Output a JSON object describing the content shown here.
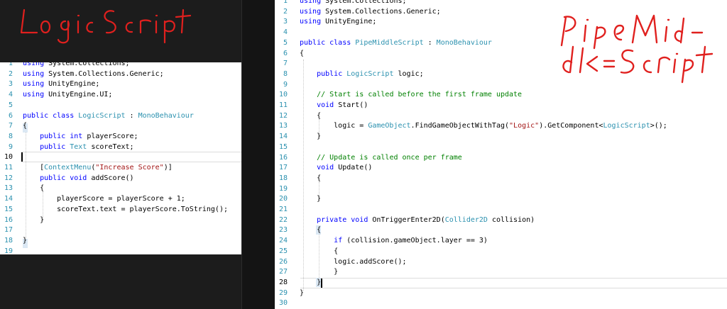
{
  "annotations": {
    "left_title": "LogicScript",
    "right_title": "PipeMiddleScript"
  },
  "left_editor": {
    "lines": [
      {
        "n": "1",
        "t": [
          [
            "k",
            "using"
          ],
          [
            "n",
            " System.Collections;"
          ]
        ]
      },
      {
        "n": "2",
        "t": [
          [
            "k",
            "using"
          ],
          [
            "n",
            " System.Collections.Generic;"
          ]
        ]
      },
      {
        "n": "3",
        "t": [
          [
            "k",
            "using"
          ],
          [
            "n",
            " UnityEngine;"
          ]
        ]
      },
      {
        "n": "4",
        "t": [
          [
            "k",
            "using"
          ],
          [
            "n",
            " UnityEngine.UI;"
          ]
        ]
      },
      {
        "n": "5",
        "t": []
      },
      {
        "n": "6",
        "t": [
          [
            "k",
            "public class"
          ],
          [
            "n",
            " "
          ],
          [
            "t",
            "LogicScript"
          ],
          [
            "n",
            " : "
          ],
          [
            "t",
            "MonoBehaviour"
          ]
        ]
      },
      {
        "n": "7",
        "t": [
          [
            "n",
            "{"
          ]
        ]
      },
      {
        "n": "8",
        "t": [
          [
            "n",
            "    "
          ],
          [
            "k",
            "public int"
          ],
          [
            "n",
            " playerScore;"
          ]
        ]
      },
      {
        "n": "9",
        "t": [
          [
            "n",
            "    "
          ],
          [
            "k",
            "public"
          ],
          [
            "n",
            " "
          ],
          [
            "t",
            "Text"
          ],
          [
            "n",
            " scoreText;"
          ]
        ]
      },
      {
        "n": "10",
        "t": []
      },
      {
        "n": "11",
        "t": [
          [
            "n",
            "    ["
          ],
          [
            "a",
            "ContextMenu"
          ],
          [
            "n",
            "("
          ],
          [
            "s",
            "\"Increase Score\""
          ],
          [
            "n",
            ")]"
          ]
        ]
      },
      {
        "n": "12",
        "t": [
          [
            "n",
            "    "
          ],
          [
            "k",
            "public void"
          ],
          [
            "n",
            " addScore()"
          ]
        ]
      },
      {
        "n": "13",
        "t": [
          [
            "n",
            "    {"
          ]
        ]
      },
      {
        "n": "14",
        "t": [
          [
            "n",
            "        playerScore = playerScore + 1;"
          ]
        ]
      },
      {
        "n": "15",
        "t": [
          [
            "n",
            "        scoreText.text = playerScore.ToString();"
          ]
        ]
      },
      {
        "n": "16",
        "t": [
          [
            "n",
            "    }"
          ]
        ]
      },
      {
        "n": "17",
        "t": []
      },
      {
        "n": "18",
        "t": [
          [
            "n",
            "}"
          ]
        ]
      },
      {
        "n": "19",
        "t": []
      }
    ]
  },
  "right_editor": {
    "lines": [
      {
        "n": "1",
        "t": [
          [
            "k",
            "using"
          ],
          [
            "n",
            " System.Collections;"
          ]
        ]
      },
      {
        "n": "2",
        "t": [
          [
            "k",
            "using"
          ],
          [
            "n",
            " System.Collections.Generic;"
          ]
        ]
      },
      {
        "n": "3",
        "t": [
          [
            "k",
            "using"
          ],
          [
            "n",
            " UnityEngine;"
          ]
        ]
      },
      {
        "n": "4",
        "t": []
      },
      {
        "n": "5",
        "t": [
          [
            "k",
            "public class"
          ],
          [
            "n",
            " "
          ],
          [
            "t",
            "PipeMiddleScript"
          ],
          [
            "n",
            " : "
          ],
          [
            "t",
            "MonoBehaviour"
          ]
        ]
      },
      {
        "n": "6",
        "t": [
          [
            "n",
            "{"
          ]
        ]
      },
      {
        "n": "7",
        "t": []
      },
      {
        "n": "8",
        "t": [
          [
            "n",
            "    "
          ],
          [
            "k",
            "public"
          ],
          [
            "n",
            " "
          ],
          [
            "t",
            "LogicScript"
          ],
          [
            "n",
            " logic;"
          ]
        ]
      },
      {
        "n": "9",
        "t": []
      },
      {
        "n": "10",
        "t": [
          [
            "n",
            "    "
          ],
          [
            "c",
            "// Start is called before the first frame update"
          ]
        ]
      },
      {
        "n": "11",
        "t": [
          [
            "n",
            "    "
          ],
          [
            "k",
            "void"
          ],
          [
            "n",
            " Start()"
          ]
        ]
      },
      {
        "n": "12",
        "t": [
          [
            "n",
            "    {"
          ]
        ]
      },
      {
        "n": "13",
        "t": [
          [
            "n",
            "        logic = "
          ],
          [
            "t",
            "GameObject"
          ],
          [
            "n",
            ".FindGameObjectWithTag("
          ],
          [
            "s",
            "\"Logic\""
          ],
          [
            "n",
            ").GetComponent<"
          ],
          [
            "t",
            "LogicScript"
          ],
          [
            "n",
            ">();"
          ]
        ]
      },
      {
        "n": "14",
        "t": [
          [
            "n",
            "    }"
          ]
        ]
      },
      {
        "n": "15",
        "t": []
      },
      {
        "n": "16",
        "t": [
          [
            "n",
            "    "
          ],
          [
            "c",
            "// Update is called once per frame"
          ]
        ]
      },
      {
        "n": "17",
        "t": [
          [
            "n",
            "    "
          ],
          [
            "k",
            "void"
          ],
          [
            "n",
            " Update()"
          ]
        ]
      },
      {
        "n": "18",
        "t": [
          [
            "n",
            "    {"
          ]
        ]
      },
      {
        "n": "19",
        "t": []
      },
      {
        "n": "20",
        "t": [
          [
            "n",
            "    }"
          ]
        ]
      },
      {
        "n": "21",
        "t": []
      },
      {
        "n": "22",
        "t": [
          [
            "n",
            "    "
          ],
          [
            "k",
            "private void"
          ],
          [
            "n",
            " OnTriggerEnter2D("
          ],
          [
            "t",
            "Collider2D"
          ],
          [
            "n",
            " collision)"
          ]
        ]
      },
      {
        "n": "23",
        "t": [
          [
            "n",
            "    {"
          ]
        ]
      },
      {
        "n": "24",
        "t": [
          [
            "n",
            "        "
          ],
          [
            "k",
            "if"
          ],
          [
            "n",
            " (collision.gameObject.layer == 3)"
          ]
        ]
      },
      {
        "n": "25",
        "t": [
          [
            "n",
            "        {"
          ]
        ]
      },
      {
        "n": "26",
        "t": [
          [
            "n",
            "        logic.addScore();"
          ]
        ]
      },
      {
        "n": "27",
        "t": [
          [
            "n",
            "        }"
          ]
        ]
      },
      {
        "n": "28",
        "t": [
          [
            "n",
            "    }"
          ]
        ]
      },
      {
        "n": "29",
        "t": [
          [
            "n",
            "}"
          ]
        ]
      },
      {
        "n": "30",
        "t": []
      }
    ]
  }
}
